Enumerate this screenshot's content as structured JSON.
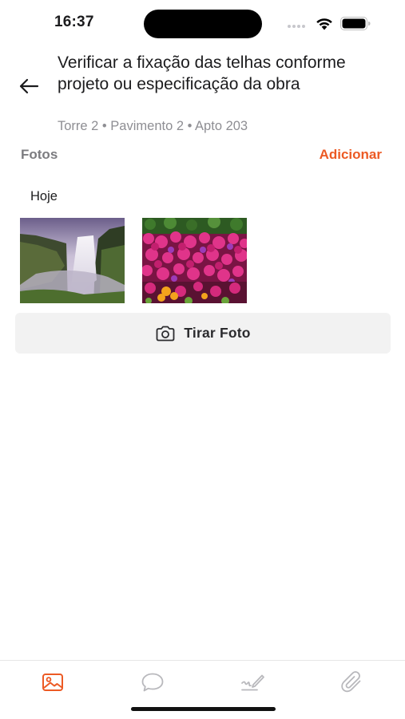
{
  "status_bar": {
    "time": "16:37"
  },
  "header": {
    "title": "Verificar a fixação das telhas conforme projeto ou especificação da obra",
    "location": "Torre 2 • Pavimento 2 • Apto 203"
  },
  "photos_section": {
    "label": "Fotos",
    "add_label": "Adicionar",
    "groups": [
      {
        "date_label": "Hoje",
        "photos": [
          {
            "subject": "waterfall"
          },
          {
            "subject": "flowers"
          }
        ]
      }
    ],
    "take_photo_label": "Tirar Foto"
  },
  "tab_bar": {
    "tabs": [
      {
        "icon": "photos-icon",
        "active": true
      },
      {
        "icon": "comment-icon",
        "active": false
      },
      {
        "icon": "signature-icon",
        "active": false
      },
      {
        "icon": "attachment-icon",
        "active": false
      }
    ]
  },
  "colors": {
    "accent": "#ec5a24",
    "inactive_icon": "#b8b8bc",
    "secondary_text": "#8e8e93",
    "button_bg": "#f2f2f2"
  }
}
